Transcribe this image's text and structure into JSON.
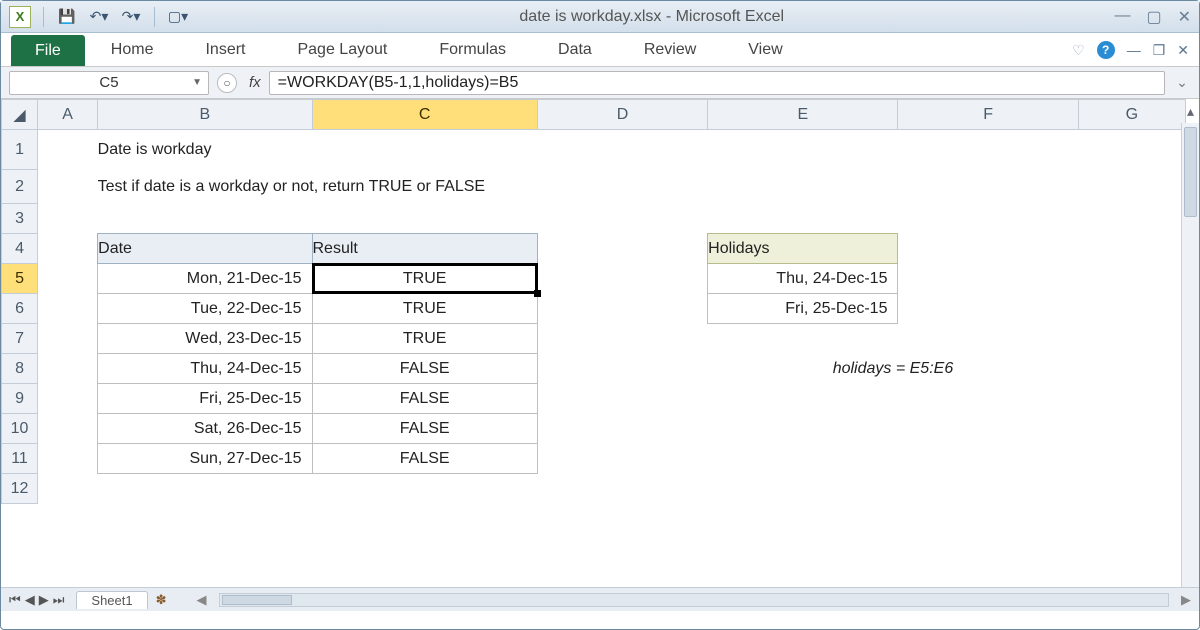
{
  "window": {
    "title": "date is workday.xlsx  -  Microsoft Excel"
  },
  "ribbon": {
    "file": "File",
    "tabs": [
      "Home",
      "Insert",
      "Page Layout",
      "Formulas",
      "Data",
      "Review",
      "View"
    ]
  },
  "formula_bar": {
    "name_box": "C5",
    "fx": "fx",
    "formula": "=WORKDAY(B5-1,1,holidays)=B5"
  },
  "columns": [
    "A",
    "B",
    "C",
    "D",
    "E",
    "F",
    "G"
  ],
  "rows": [
    "1",
    "2",
    "3",
    "4",
    "5",
    "6",
    "7",
    "8",
    "9",
    "10",
    "11",
    "12"
  ],
  "content": {
    "title": "Date is workday",
    "subtitle": "Test if date is a workday or not, return TRUE or FALSE",
    "headers": {
      "date": "Date",
      "result": "Result",
      "holidays": "Holidays"
    },
    "dates": [
      "Mon, 21-Dec-15",
      "Tue, 22-Dec-15",
      "Wed, 23-Dec-15",
      "Thu, 24-Dec-15",
      "Fri, 25-Dec-15",
      "Sat, 26-Dec-15",
      "Sun, 27-Dec-15"
    ],
    "results": [
      "TRUE",
      "TRUE",
      "TRUE",
      "FALSE",
      "FALSE",
      "FALSE",
      "FALSE"
    ],
    "holidays": [
      "Thu, 24-Dec-15",
      "Fri, 25-Dec-15"
    ],
    "note": "holidays = E5:E6"
  },
  "sheet_bar": {
    "sheet1": "Sheet1"
  },
  "chart_data": {
    "type": "table",
    "title": "Date is workday",
    "columns": [
      "Date",
      "Result"
    ],
    "rows": [
      [
        "Mon, 21-Dec-15",
        "TRUE"
      ],
      [
        "Tue, 22-Dec-15",
        "TRUE"
      ],
      [
        "Wed, 23-Dec-15",
        "TRUE"
      ],
      [
        "Thu, 24-Dec-15",
        "FALSE"
      ],
      [
        "Fri, 25-Dec-15",
        "FALSE"
      ],
      [
        "Sat, 26-Dec-15",
        "FALSE"
      ],
      [
        "Sun, 27-Dec-15",
        "FALSE"
      ]
    ],
    "aux": {
      "Holidays": [
        "Thu, 24-Dec-15",
        "Fri, 25-Dec-15"
      ]
    }
  }
}
